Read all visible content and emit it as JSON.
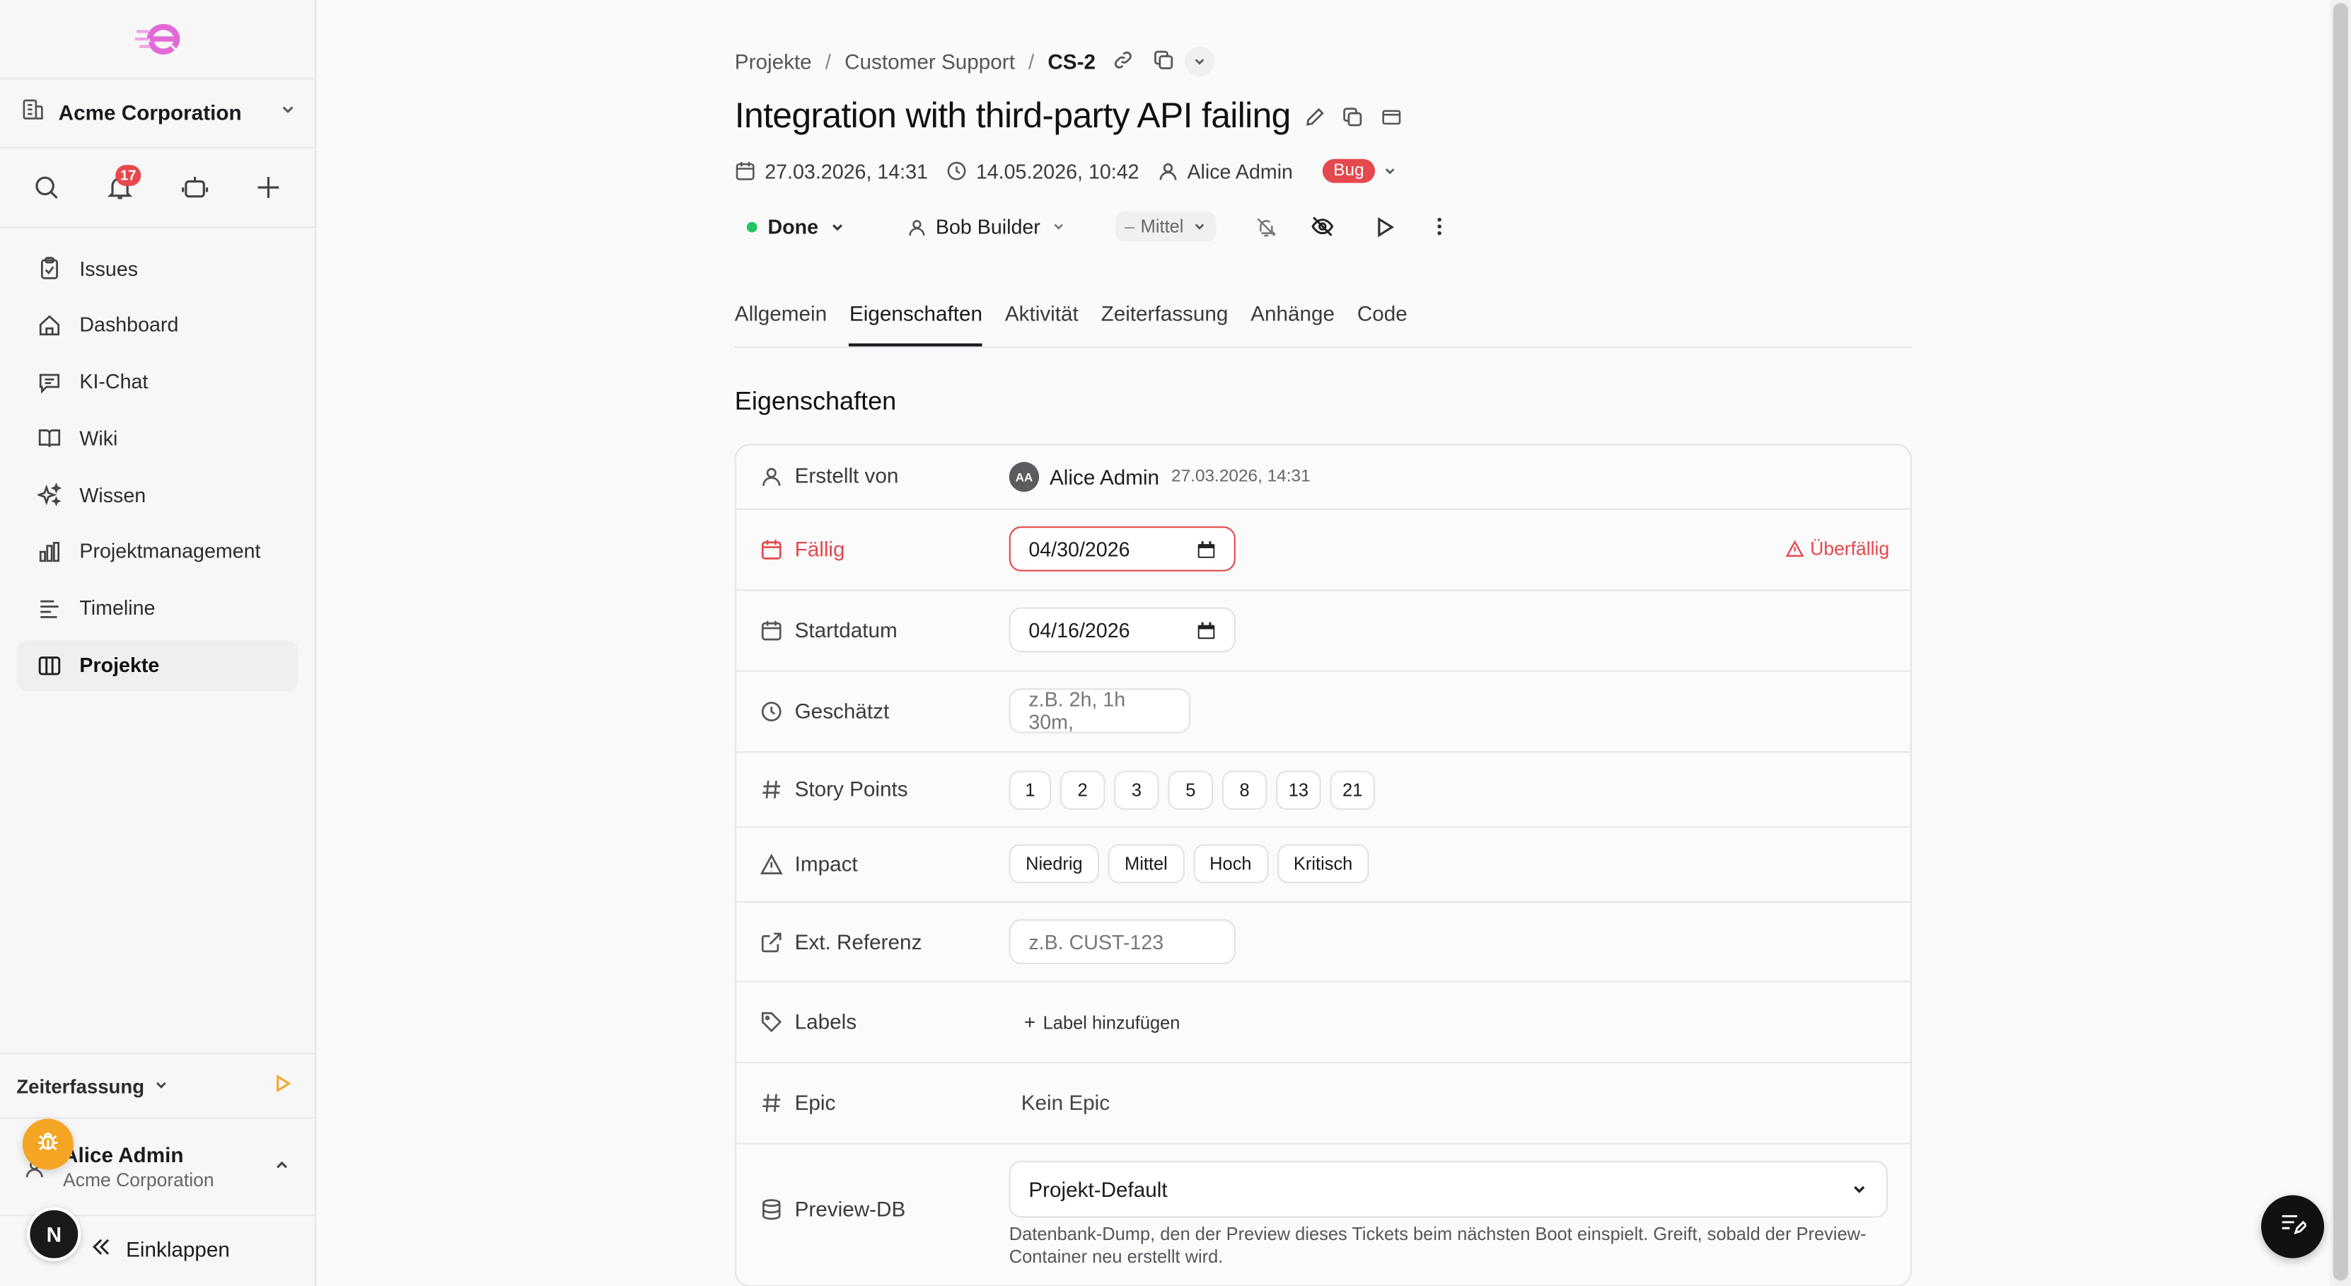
{
  "sidebar": {
    "org_name": "Acme Corporation",
    "notifications_count": "17",
    "nav": [
      {
        "label": "Issues",
        "icon": "clipboard-icon"
      },
      {
        "label": "Dashboard",
        "icon": "home-icon"
      },
      {
        "label": "KI-Chat",
        "icon": "chat-icon"
      },
      {
        "label": "Wiki",
        "icon": "book-icon"
      },
      {
        "label": "Wissen",
        "icon": "sparkles-icon"
      },
      {
        "label": "Projektmanagement",
        "icon": "bar-chart-icon"
      },
      {
        "label": "Timeline",
        "icon": "timeline-icon"
      },
      {
        "label": "Projekte",
        "icon": "columns-icon",
        "active": true
      }
    ],
    "time_tracking_label": "Zeiterfassung",
    "user_name": "Alice Admin",
    "user_org": "Acme Corporation",
    "n_avatar": "N",
    "collapse_label": "Einklappen"
  },
  "breadcrumb": {
    "projects": "Projekte",
    "project": "Customer Support",
    "issue_key": "CS-2"
  },
  "issue": {
    "title": "Integration with third-party API failing",
    "created": "27.03.2026, 14:31",
    "updated": "14.05.2026, 10:42",
    "author": "Alice Admin",
    "type_badge": "Bug",
    "status": "Done",
    "assignee": "Bob Builder",
    "priority": "Mittel"
  },
  "tabs": [
    "Allgemein",
    "Eigenschaften",
    "Aktivität",
    "Zeiterfassung",
    "Anhänge",
    "Code"
  ],
  "active_tab": "Eigenschaften",
  "properties": {
    "section_title": "Eigenschaften",
    "created_by_label": "Erstellt von",
    "created_by_initials": "AA",
    "created_by_name": "Alice Admin",
    "created_by_date": "27.03.2026, 14:31",
    "due_label": "Fällig",
    "due_value": "04/30/2026",
    "overdue_label": "Überfällig",
    "start_label": "Startdatum",
    "start_value": "04/16/2026",
    "estimate_label": "Geschätzt",
    "estimate_placeholder": "z.B. 2h, 1h 30m,",
    "story_points_label": "Story Points",
    "story_points": [
      "1",
      "2",
      "3",
      "5",
      "8",
      "13",
      "21"
    ],
    "impact_label": "Impact",
    "impact_options": [
      "Niedrig",
      "Mittel",
      "Hoch",
      "Kritisch"
    ],
    "ext_ref_label": "Ext. Referenz",
    "ext_ref_placeholder": "z.B. CUST-123",
    "labels_label": "Labels",
    "add_label": "Label hinzufügen",
    "epic_label": "Epic",
    "epic_value": "Kein Epic",
    "preview_db_label": "Preview-DB",
    "preview_db_value": "Projekt-Default",
    "preview_db_hint": "Datenbank-Dump, den der Preview dieses Tickets beim nächsten Boot einspielt. Greift, sobald der Preview-Container neu erstellt wird."
  },
  "colors": {
    "accent_red": "#e5484d",
    "status_green": "#22c55e",
    "fab_orange": "#f5a524",
    "logo_pink": "#e26ad8"
  }
}
